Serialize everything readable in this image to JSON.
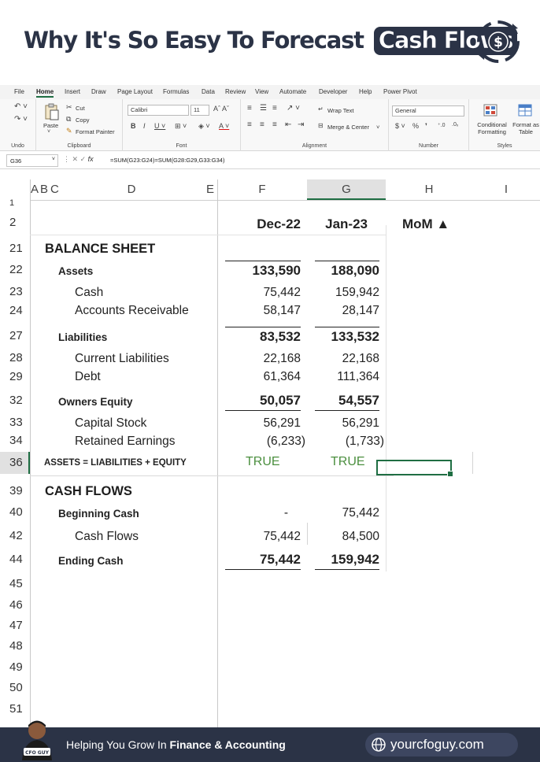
{
  "banner": {
    "title_plain": "Why It's So Easy To Forecast",
    "title_highlight": "Cash Flows",
    "icon": "dollar-cycle-icon"
  },
  "ribbon": {
    "tabs": [
      "File",
      "Home",
      "Insert",
      "Draw",
      "Page Layout",
      "Formulas",
      "Data",
      "Review",
      "View",
      "Automate",
      "Developer",
      "Help",
      "Power Pivot"
    ],
    "active_tab": "Home",
    "groups": {
      "undo": "Undo",
      "clipboard": "Clipboard",
      "font": "Font",
      "alignment": "Alignment",
      "number": "Number",
      "styles": "Styles"
    },
    "paste": "Paste",
    "cut": "Cut",
    "copy": "Copy",
    "format_painter": "Format Painter",
    "font_name": "Calibri",
    "font_size": "11",
    "wrap_text": "Wrap Text",
    "merge_center": "Merge & Center",
    "number_format": "General",
    "conditional_formatting": "Conditional Formatting",
    "format_as_table": "Format as Table"
  },
  "formula_bar": {
    "name_box": "G36",
    "formula": "=SUM(G23:G24)=SUM(G28:G29,G33:G34)"
  },
  "columns": [
    "A",
    "B",
    "C",
    "D",
    "E",
    "F",
    "G",
    "H",
    "I"
  ],
  "rows": [
    "1",
    "2",
    "21",
    "22",
    "23",
    "24",
    "27",
    "28",
    "29",
    "32",
    "33",
    "34",
    "36",
    "39",
    "40",
    "42",
    "44",
    "45",
    "46",
    "47",
    "48",
    "49",
    "50",
    "51"
  ],
  "headers": {
    "col_f": "Dec-22",
    "col_g": "Jan-23",
    "col_h": "MoM ▲"
  },
  "balance_sheet": {
    "title": "BALANCE SHEET",
    "assets": {
      "label": "Assets",
      "f": "133,590",
      "g": "188,090"
    },
    "cash": {
      "label": "Cash",
      "f": "75,442",
      "g": "159,942"
    },
    "ar": {
      "label": "Accounts Receivable",
      "f": "58,147",
      "g": "28,147"
    },
    "liabilities": {
      "label": "Liabilities",
      "f": "83,532",
      "g": "133,532"
    },
    "current_liab": {
      "label": "Current Liabilities",
      "f": "22,168",
      "g": "22,168"
    },
    "debt": {
      "label": "Debt",
      "f": "61,364",
      "g": "111,364"
    },
    "equity": {
      "label": "Owners Equity",
      "f": "50,057",
      "g": "54,557"
    },
    "capital_stock": {
      "label": "Capital Stock",
      "f": "56,291",
      "g": "56,291"
    },
    "retained": {
      "label": "Retained Earnings",
      "f": "(6,233)",
      "g": "(1,733)"
    },
    "check": {
      "label": "ASSETS = LIABILITIES + EQUITY",
      "f": "TRUE",
      "g": "TRUE"
    }
  },
  "cash_flows": {
    "title": "CASH FLOWS",
    "beginning": {
      "label": "Beginning Cash",
      "f": "-",
      "g": "75,442"
    },
    "flows": {
      "label": "Cash Flows",
      "f": "75,442",
      "g": "84,500"
    },
    "ending": {
      "label": "Ending Cash",
      "f": "75,442",
      "g": "159,942"
    }
  },
  "footer": {
    "tagline_plain": "Helping You Grow In",
    "tagline_bold": "Finance & Accounting",
    "url": "yourcfoguy.com",
    "avatar_badge": "CFO GUY"
  },
  "colors": {
    "navy": "#2b3346",
    "excel_green": "#1f6e43",
    "true_green": "#4b8f3f"
  }
}
